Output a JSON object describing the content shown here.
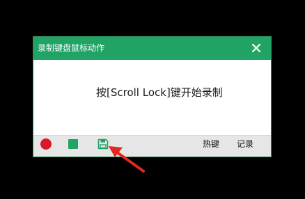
{
  "window": {
    "title": "录制键盘鼠标动作",
    "close_icon": "close-icon"
  },
  "content": {
    "hint": "按[Scroll Lock]键开始录制"
  },
  "toolbar": {
    "record_icon": "record-icon",
    "stop_icon": "stop-icon",
    "save_icon": "save-icon",
    "hotkey_label": "热键",
    "records_label": "记录"
  },
  "colors": {
    "accent": "#21a366",
    "record": "#d7192a",
    "annotation_arrow": "#e4261f",
    "background": "#000000"
  }
}
